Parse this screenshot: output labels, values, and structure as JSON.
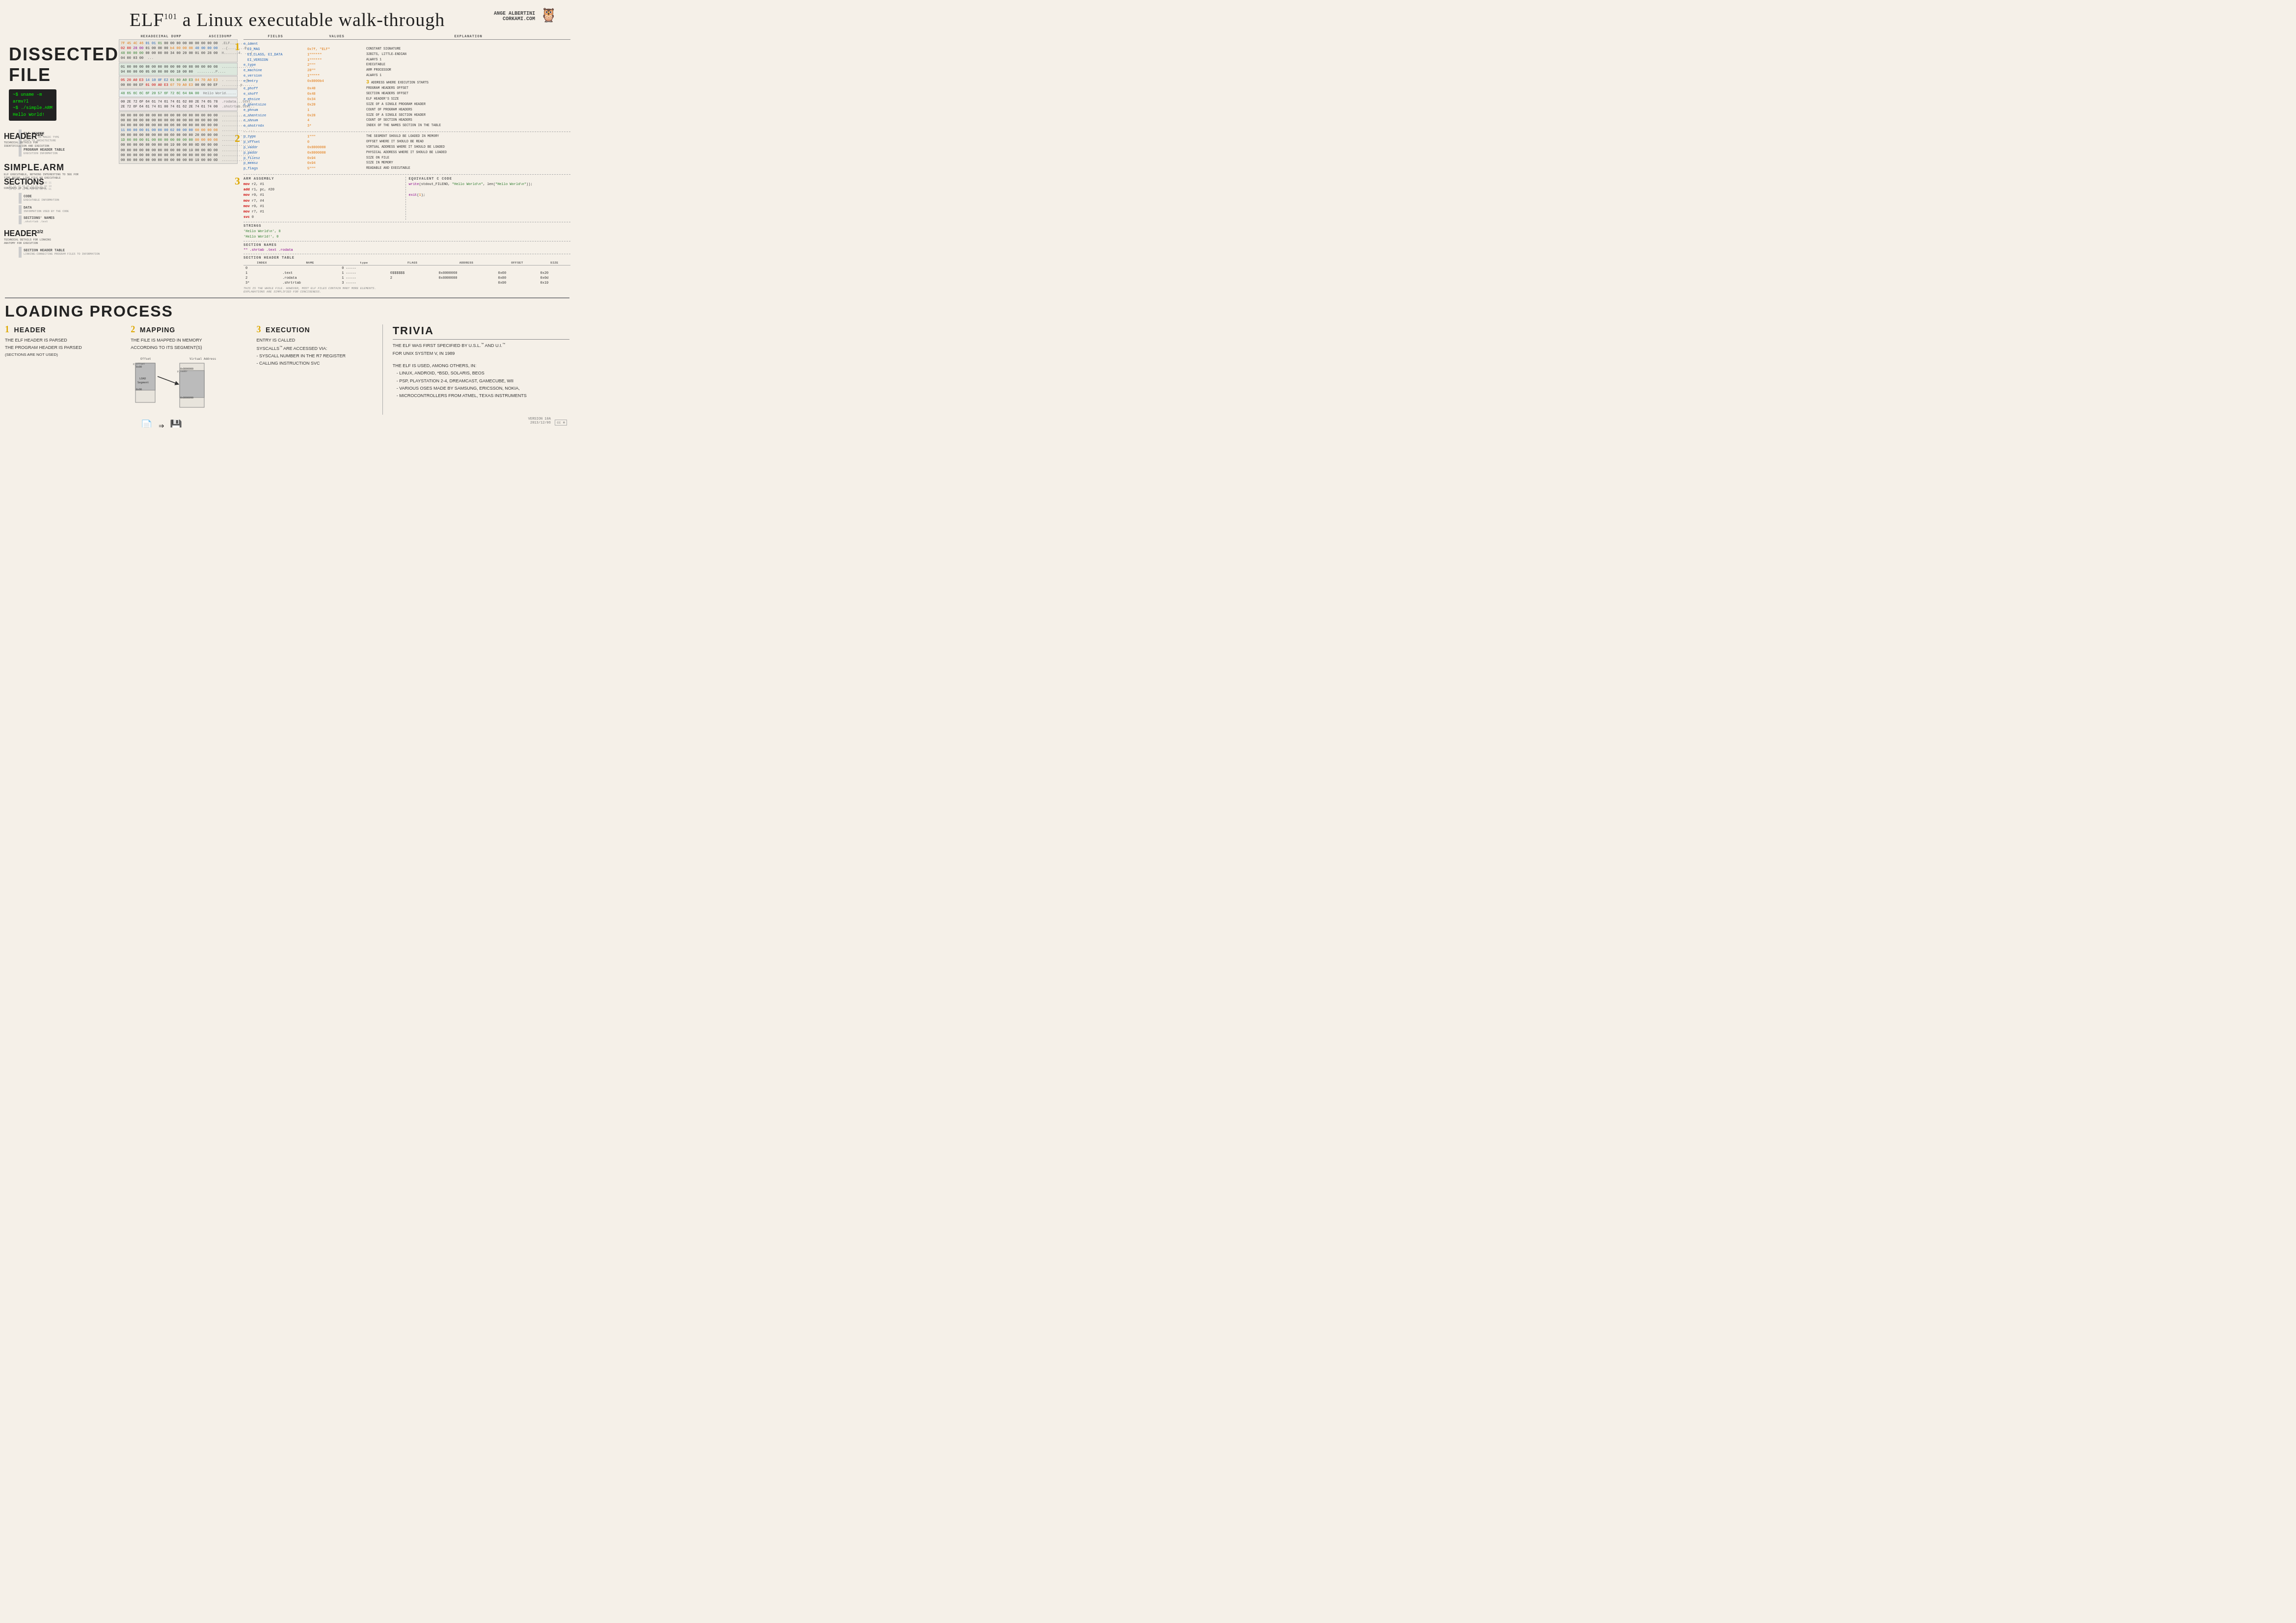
{
  "title": {
    "main": "ELF",
    "sup": "101",
    "subtitle": "a Linux executable walk-through",
    "author": "ANGE ALBERTINI\nCORKAMI.COM"
  },
  "dissected": {
    "title": "DISSECTED FILE",
    "terminal": "~$ uname -m\narmv7l\n~$ ./simple.ARM\nHello World!"
  },
  "sections": {
    "header1": {
      "title": "HEADER",
      "sup": "1/2",
      "sub": "TECHNICAL DETAILS FOR\nIDENTIFICATION AND EXECUTION"
    },
    "simple_arm": {
      "title": "SIMPLE.ARM",
      "sub": "ELF EXECUTABLE, NOTHING INTERESTING TO SEE FOR\nTIME BEING, LIKE FILE NO EXECUTABLE"
    },
    "sections": {
      "title": "SECTIONS",
      "sub": "CONTENTS OF THE EXECUTABLE"
    },
    "header2": {
      "title": "HEADER",
      "sup": "2/2",
      "sub": "TECHNICAL DETAILS FOR LINKING\nANATOMY FOR EXECUTION"
    },
    "elf_header": {
      "label": "ELF HEADER",
      "sub": "IDENTITY AS MAGIC TYPE\nPATH TO ARCHITECTURE"
    },
    "program_header": {
      "label": "PROGRAM HEADER TABLE",
      "sub": "EXECUTION INFORMATION"
    },
    "code": {
      "label": "CODE",
      "sub": "EXECUTABLE INFORMATION"
    },
    "data": {
      "label": "DATA",
      "sub": "INFORMATION USED BY THE CODE"
    },
    "section_names": {
      "label": "SECTIONS' NAMES",
      "sub": ".shstrtab .text"
    },
    "section_header": {
      "label": "SECTION HEADER TABLE",
      "sub": "LINKING-CONNECTING PROGRAM FILES TO INFORMATION"
    }
  },
  "hex_dump_label": "HEXADECIMAL DUMP",
  "ascii_dump_label": "ASCIIDUMP",
  "fields_label": "FIELDS",
  "values_label": "VALUES",
  "explanation_label": "EXPLANATION",
  "elf_fields": [
    {
      "name": "e_ident",
      "value": "",
      "explain": ""
    },
    {
      "name": "EI_MAG",
      "value": "0x7f, \"ELF\"",
      "explain": "CONSTANT SIGNATURE"
    },
    {
      "name": "EI_CLASS, EI_DATA",
      "value": "1\"\"\"\"\"",
      "explain": "32BITS, LITTLE-ENDIAN"
    },
    {
      "name": "EI_VERSION",
      "value": "1",
      "explain": "ALWAYS 1"
    },
    {
      "name": "e_type",
      "value": "2\"\"\"",
      "explain": "EXECUTABLE"
    },
    {
      "name": "e_machine",
      "value": "28\"\"",
      "explain": "ARM PROCESSOR"
    },
    {
      "name": "e_version",
      "value": "1\"\"\"\"\"",
      "explain": "ALWAYS 1"
    },
    {
      "name": "e_entry",
      "value": "0x8000b4",
      "explain": "3 ADDRESS WHERE EXECUTION STARTS"
    },
    {
      "name": "e_phoff",
      "value": "0x40",
      "explain": "PROGRAM HEADERS OFFSET"
    },
    {
      "name": "e_shoff",
      "value": "0x48",
      "explain": "SECTION HEADERS OFFSET"
    },
    {
      "name": "e_ehsize",
      "value": "0x34",
      "explain": "ELF HEADER'S SIZE"
    },
    {
      "name": "e_phentsize",
      "value": "0x20",
      "explain": "SIZE OF A SINGLE PROGRAM HEADER"
    },
    {
      "name": "e_phnum",
      "value": "1",
      "explain": "COUNT OF PROGRAM HEADERS"
    },
    {
      "name": "e_shentsize",
      "value": "0x28",
      "explain": "SIZE OF A SINGLE SECTION HEADER"
    },
    {
      "name": "e_shnum",
      "value": "4",
      "explain": "COUNT OF SECTION HEADERS"
    },
    {
      "name": "e_shstrndx",
      "value": "3*",
      "explain": "INDEX OF THE NAMES SECTION IN THE TABLE"
    }
  ],
  "program_fields": [
    {
      "name": "p_type",
      "value": "1\"\"\"",
      "explain": "THE SEGMENT SHOULD BE LOADED IN MEMORY"
    },
    {
      "name": "p_offset",
      "value": "0",
      "explain": "OFFSET WHERE IT SHOULD BE READ"
    },
    {
      "name": "p_vaddr",
      "value": "0x8000000",
      "explain": "VIRTUAL ADDRESS WHERE IT SHOULD BE LOADED"
    },
    {
      "name": "p_paddr",
      "value": "0x8000000",
      "explain": "PHYSICAL ADDRESS WHERE IT SHOULD BE LOADED"
    },
    {
      "name": "p_filesz",
      "value": "0x94",
      "explain": "SIZE ON FILE"
    },
    {
      "name": "p_memsz",
      "value": "0x94",
      "explain": "SIZE IN MEMORY"
    },
    {
      "name": "p_flags",
      "value": "5\"\"\"",
      "explain": "READABLE AND EXECUTABLE"
    }
  ],
  "arm_assembly": [
    "mov r2, #1",
    "add r1, pc, #20",
    "mov r0, #1",
    "mov r7, #4",
    "  →write(stdout_FILENO, \"Hello World\\n\", len(\"Hello World\\n\"));",
    "mov r0, #1",
    "mov r7, #1",
    "  →exit(1);"
  ],
  "strings": {
    "label": "STRINGS",
    "values": [
      "'Hello World\\n', 8",
      "'Hello World!', 0"
    ]
  },
  "section_names_data": {
    "label": "SECTION NAMES",
    "values": "\"\" .shrtab .text .rodata"
  },
  "section_header_table": {
    "label": "SECTION HEADER TABLE",
    "columns": [
      "INDEX",
      "NAME",
      "TYPE",
      "FLAGS",
      "ADDRESS",
      "OFFSET",
      "SIZE"
    ],
    "rows": [
      {
        "idx": "0",
        "name": "",
        "type": "0 -----",
        "flags": "",
        "address": "",
        "offset": "",
        "size": ""
      },
      {
        "idx": "1",
        "name": ".text",
        "type": "1 -----",
        "flags": "6$$$$$$",
        "address": "0x8000060",
        "offset": "0x60",
        "size": "0x20"
      },
      {
        "idx": "2",
        "name": ".rodata",
        "type": "1 -----",
        "flags": "2",
        "address": "0x8000080",
        "offset": "0x80",
        "size": "0x0d"
      },
      {
        "idx": "3*",
        "name": ".shrtrtab",
        "type": "3 -----",
        "flags": "",
        "address": "",
        "offset": "0x90",
        "size": "0x19"
      }
    ]
  },
  "loading": {
    "title": "LOADING PROCESS",
    "steps": [
      {
        "num": "1",
        "title": "HEADER",
        "body": "THE ELF HEADER IS PARSED\nTHE PROGRAM HEADER IS PARSED\n(SECTIONS ARE NOT USED)"
      },
      {
        "num": "2",
        "title": "MAPPING",
        "body": "THE FILE IS MAPPED IN MEMORY\nACCORDING TO ITS SEGMENT(S)"
      },
      {
        "num": "3",
        "title": "EXECUTION",
        "body": "ENTRY IS CALLED\nSYSCALLS™ ARE ACCESSED VIA:\n- SYSCALL NUMBER IN THE R7 REGISTER\n- CALLING INSTRUCTION SVC"
      }
    ]
  },
  "trivia": {
    "title": "TRIVIA",
    "body": "THE ELF WAS FIRST SPECIFIED BY U.S.L.™ AND U.I.™\nFOR UNIX SYSTEM V, IN 1989",
    "items": [
      "THE ELF IS USED, AMONG OTHERS, IN:",
      " - LINUX, ANDROID, *BSD, SOLARIS, BEOS",
      " - PSP, PLAYSTATION 2-4, DREAMCAST, GAMECUBE, WII",
      " - VARIOUS OSES MADE BY SAMSUNG, ERICSSON, NOKIA,",
      " - MICROCONTROLLERS FROM ATMEL, TEXAS INSTRUMENTS"
    ]
  },
  "version": "VERSION 10A\n2013/12/06",
  "hex_lines": {
    "elf_header": [
      "7F 45 4C 46 01 01 01 00  00 00 00 00 00 00 00 00  .ELF............",
      "02 00 28 00 01 00 00 00  b4 00 00 08 40 00 00 00  ..(........@...",
      "48 00 00 00 00 00 00 00  34 00 20 00 01 00 28 00  H.......4. ...(.",
      "04 00 03 00                                        ..."
    ],
    "program_header": [
      "01 00 00 00 00 00 00 00  00 00 00 08 00 00 00 08  ................",
      "94 00 00 00 05 00 00 00  00 10 00 00             .........P...."
    ],
    "code": [
      "05 20 A0 E3 14 10 8F E2 01 00 A0 E3 04 70 A0 E3  . ..........p..",
      "00 00 00 EF 01 00 A0 E3 07 70 A0 E3 00 00 00 EF  .........p......"
    ],
    "data": [
      "48 65 6C 6C 6F 20 57 6F  72 6C 64 0A 00          Hello World....."
    ],
    "section_names": [
      "00 2E 72 6F 64 61 74 61  62 00 2E 74 65 78 74 00  ..rodata...text.",
      "2E 72 6F 64 61 74 61 00  74 61 62 2E 74 61 74 00  .rodata.tab.tat."
    ],
    "section_header_data": [
      "00 00 00 00 00 00 00 00  00 00 00 00 00 00 00 00  ................",
      "00 00 00 00 00 00 00 00  00 00 00 00 00 00 00 00  ................",
      "04 00 00 00 00 00 00 00  06 00 00 00 00 00 00 00  ................",
      "11 00 00 00 01 00 00 00  02 00 00 00 60 00 00 08  ............`...",
      "00 00 00 00 00 00 00 00  60 00 00 00 20 00 00 00  ........`... ...",
      "1D 00 00 00 01 00 00 00  00 00 00 00 80 00 00 08  ................",
      "00 00 00 00 00 00 00 00  19 00 00 00 0D 00 00 00  ................",
      "00 00 00 00 00 00 00 00  00 00 00 19 00 00 0D 00  ................"
    ]
  },
  "type_label": "type"
}
